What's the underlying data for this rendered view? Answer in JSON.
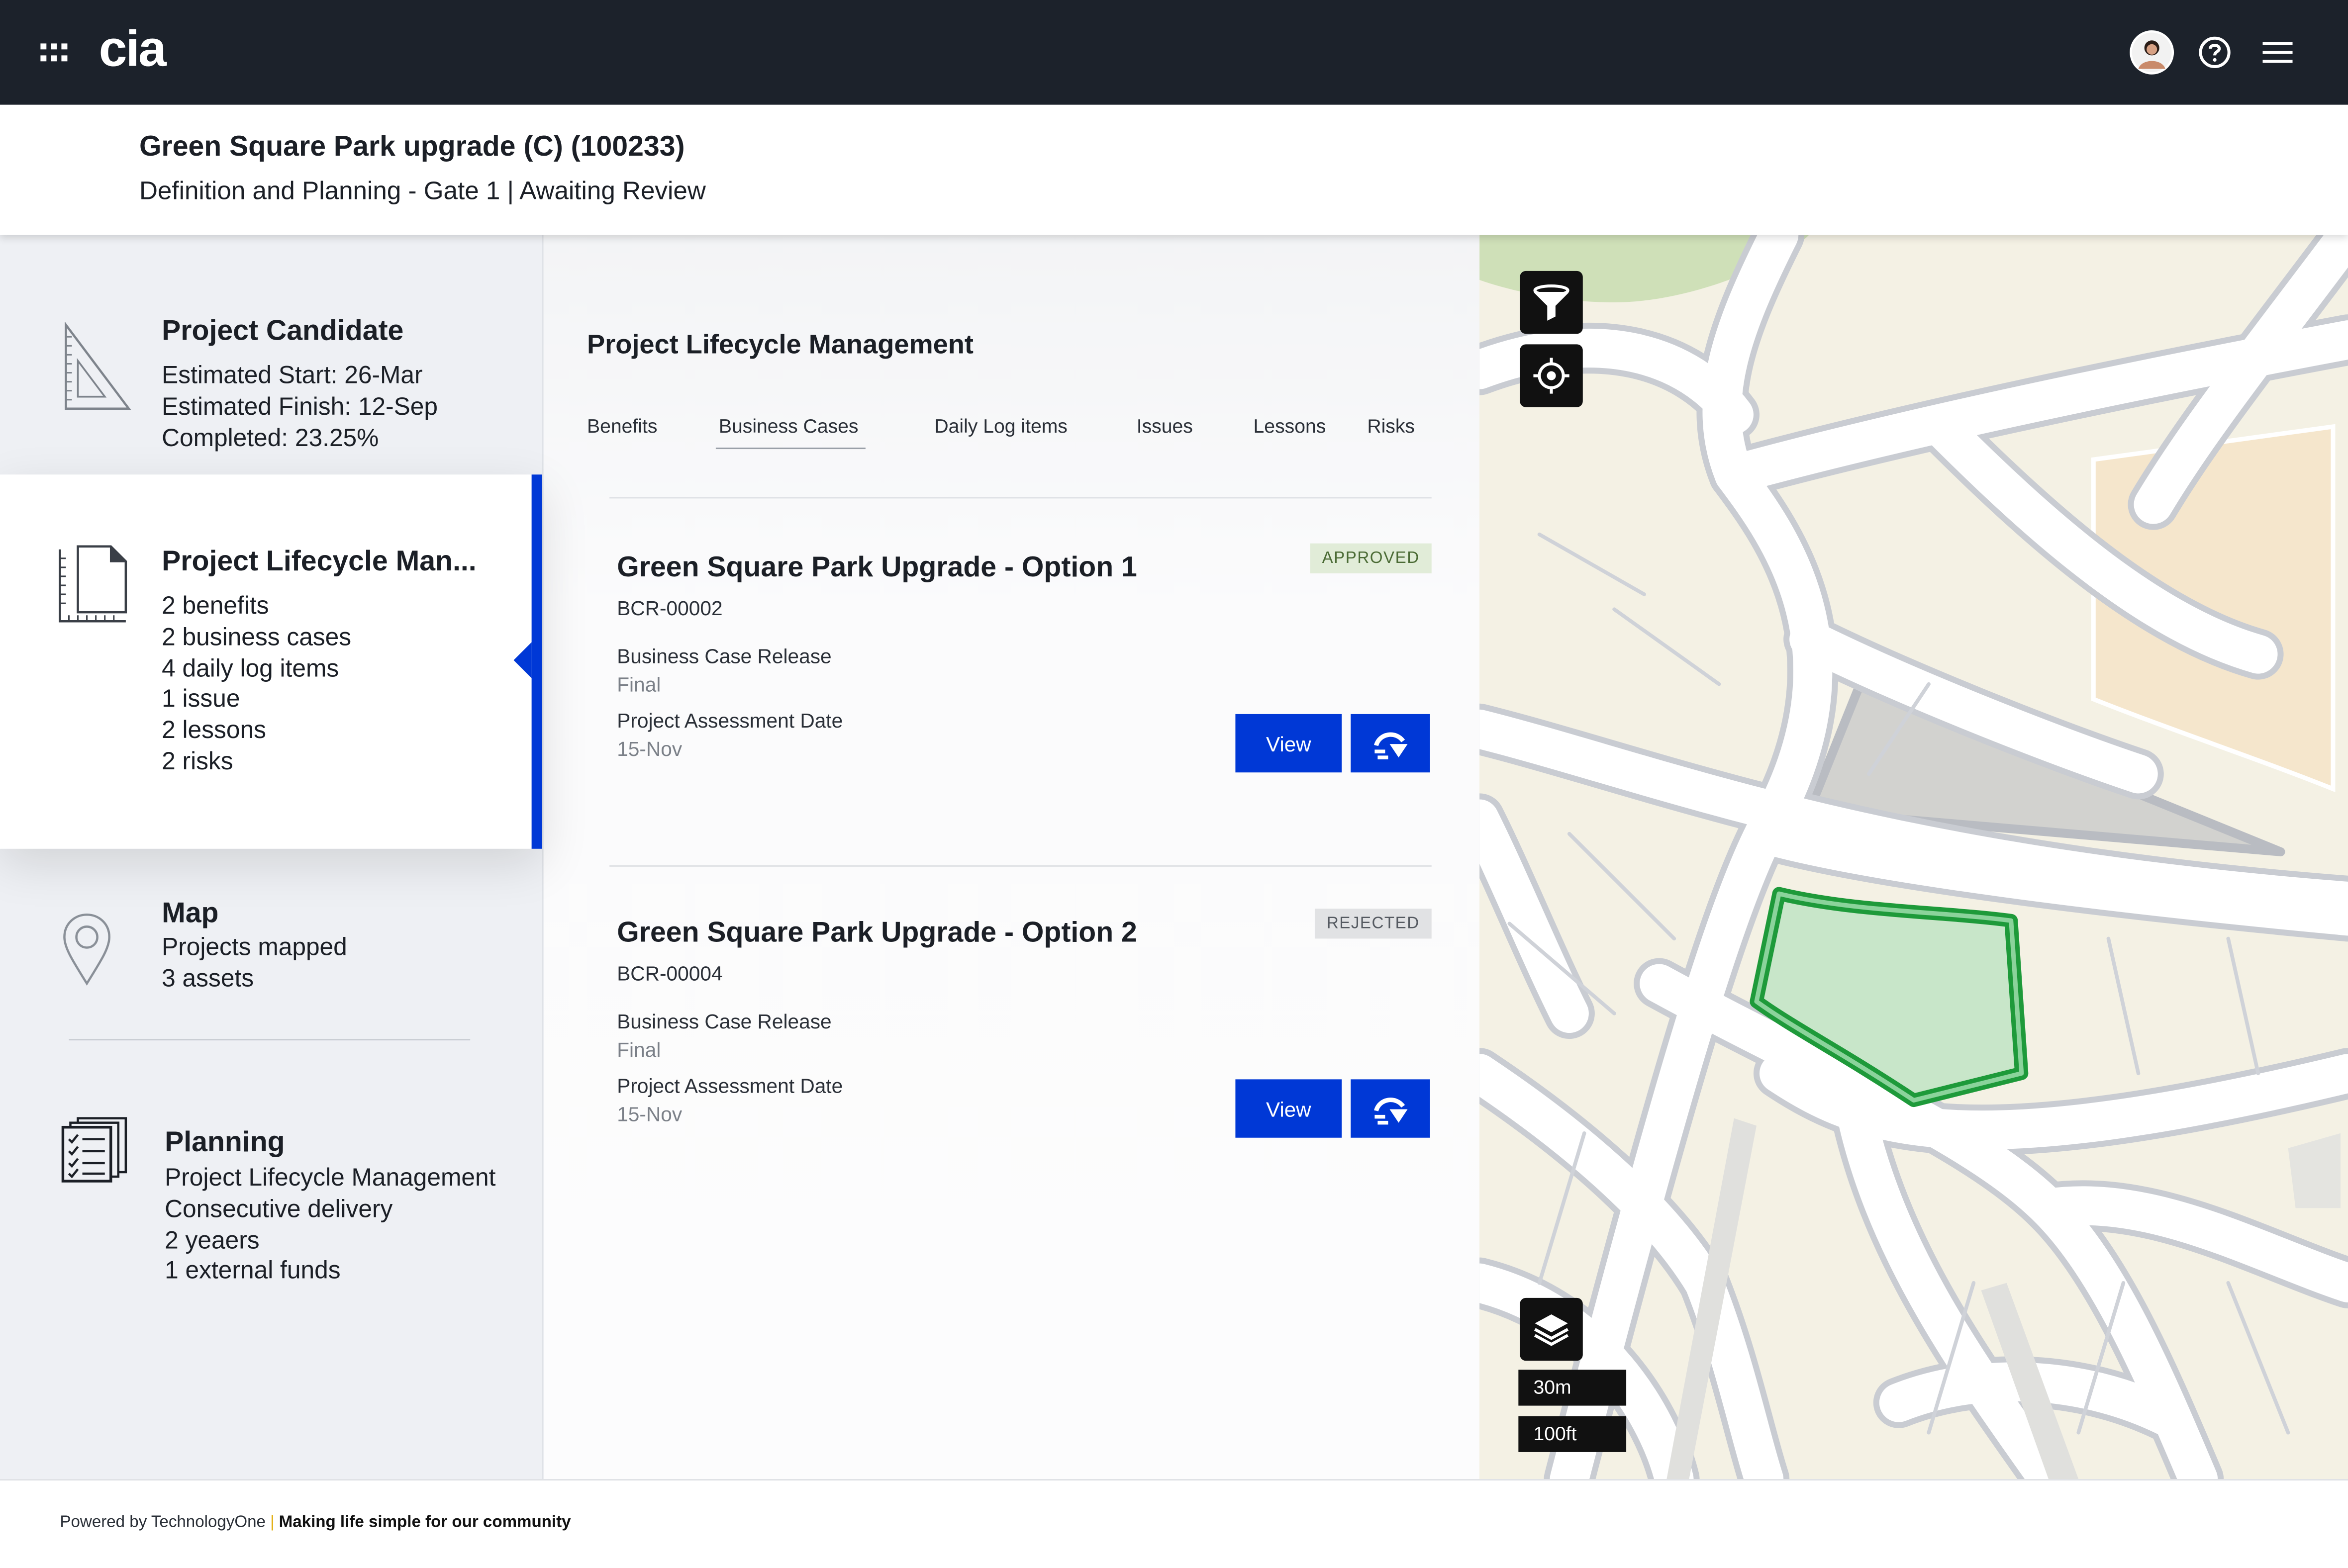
{
  "app": {
    "logo": "cia",
    "brand_color": "#0038d6",
    "topbar_color": "#1c222b"
  },
  "topbar": {
    "icons": [
      "apps-grid-icon",
      "user-avatar",
      "help-icon",
      "menu-icon"
    ]
  },
  "header": {
    "title": "Green Square Park upgrade (C) (100233)",
    "subtitle": "Definition and Planning - Gate 1 | Awaiting Review"
  },
  "sidebar": {
    "items": [
      {
        "title": "Project Candidate",
        "icon": "set-square-icon",
        "lines": [
          "Estimated Start: 26-Mar",
          "Estimated Finish: 12-Sep",
          "Completed: 23.25%"
        ]
      },
      {
        "title": "Project Lifecycle Man...",
        "icon": "document-ruler-icon",
        "active": true,
        "lines": [
          "2 benefits",
          "2 business cases",
          "4 daily log items",
          "1  issue",
          "2 lessons",
          "2 risks"
        ]
      },
      {
        "title": "Map",
        "icon": "map-pin-icon",
        "lines": [
          "Projects mapped",
          "3 assets"
        ]
      },
      {
        "title": "Planning",
        "icon": "checklist-icon",
        "lines": [
          "Project Lifecycle Management",
          "Consecutive delivery",
          "2 yeaers",
          "1  external funds"
        ]
      }
    ]
  },
  "main": {
    "title": "Project Lifecycle Management",
    "tabs": [
      "Benefits",
      "Business Cases",
      "Daily Log items",
      "Issues",
      "Lessons",
      "Risks"
    ],
    "selected_tab": "Business Cases",
    "cards": [
      {
        "title": "Green Square Park Upgrade - Option 1",
        "id": "BCR-00002",
        "status": "APPROVED",
        "release_label": "Business Case Release",
        "release_value": "Final",
        "date_label": "Project Assessment Date",
        "date_value": "15-Nov",
        "view_label": "View"
      },
      {
        "title": "Green Square Park Upgrade - Option 2",
        "id": "BCR-00004",
        "status": "REJECTED",
        "release_label": "Business Case Release",
        "release_value": "Final",
        "date_label": "Project Assessment Date",
        "date_value": "15-Nov",
        "view_label": "View"
      }
    ]
  },
  "map": {
    "controls": [
      "filter-icon",
      "locate-icon",
      "layers-icon"
    ],
    "scale_metric": "30m",
    "scale_imperial": "100ft",
    "highlight_color": "#1e9a3a"
  },
  "footer": {
    "powered": "Powered by TechnologyOne",
    "tagline": "Making life simple for our community"
  }
}
